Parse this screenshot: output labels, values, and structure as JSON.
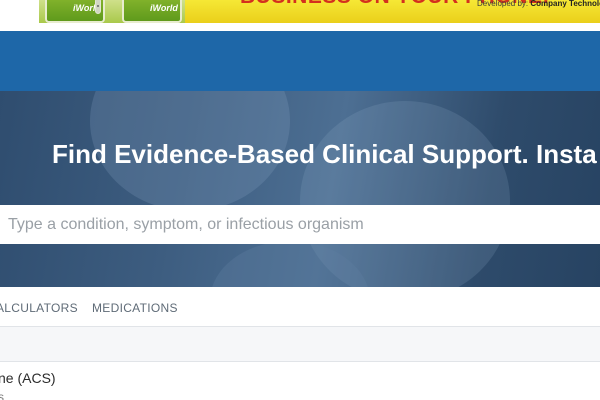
{
  "ad": {
    "device_label": "iWorld",
    "slogan": "BUSINESS ON YOUR PHONE!",
    "developed_by_prefix": "Developed by: ",
    "developer": "Company Technolo"
  },
  "hero": {
    "title": "Find Evidence-Based Clinical Support. Insta"
  },
  "search": {
    "placeholder": "Type a condition, symptom, or infectious organism"
  },
  "tabs": [
    {
      "label": "ALCULATORS"
    },
    {
      "label": "MEDICATIONS"
    }
  ],
  "results": [
    {
      "title": "ne (ACS)",
      "subtitle": "s"
    }
  ],
  "colors": {
    "nav": "#1e67a8",
    "hero": "#2f4d6f",
    "tab_text": "#5f6b77"
  }
}
